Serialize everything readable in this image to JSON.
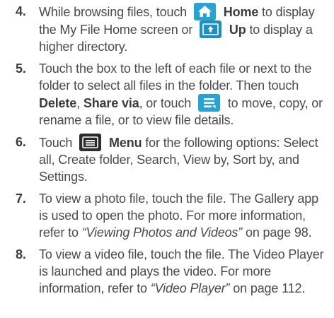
{
  "steps": [
    {
      "num": "4.",
      "t1": "While browsing files, touch",
      "home_label": "Home",
      "t2": "to display the My File Home screen or",
      "up_label": "Up",
      "t3": "to display a higher directory.",
      "icons": [
        "home-icon",
        "up-icon"
      ]
    },
    {
      "num": "5.",
      "t1": "Touch the box to the left of each file or next to the folder to select all files in the folder. Then touch",
      "delete_label": "Delete",
      "comma": ",",
      "share_label": "Share via",
      "t2": ", or touch",
      "t3": "to move, copy, or rename a file, or to view file details.",
      "icons": [
        "options-icon"
      ]
    },
    {
      "num": "6.",
      "t1": "Touch",
      "menu_label": "Menu",
      "t2": "for the following options: Select all, Create folder, Search, View by, Sort by, and Settings.",
      "icons": [
        "menu-icon"
      ]
    },
    {
      "num": "7.",
      "t1": "To view a photo file, touch the file. The Gallery app is used to open the photo. For more information, refer to",
      "ref": "“Viewing Photos and Videos”",
      "t2": "on page 98."
    },
    {
      "num": "8.",
      "t1": "To view a video file, touch the file. The Video Player is launched and plays the video. For more information, refer to",
      "ref": "“Video Player”",
      "t2": "on page 112."
    }
  ],
  "colors": {
    "icon_blue": "#27a2d1",
    "icon_dark": "#2b2b2b",
    "text": "#4a4a4a"
  }
}
